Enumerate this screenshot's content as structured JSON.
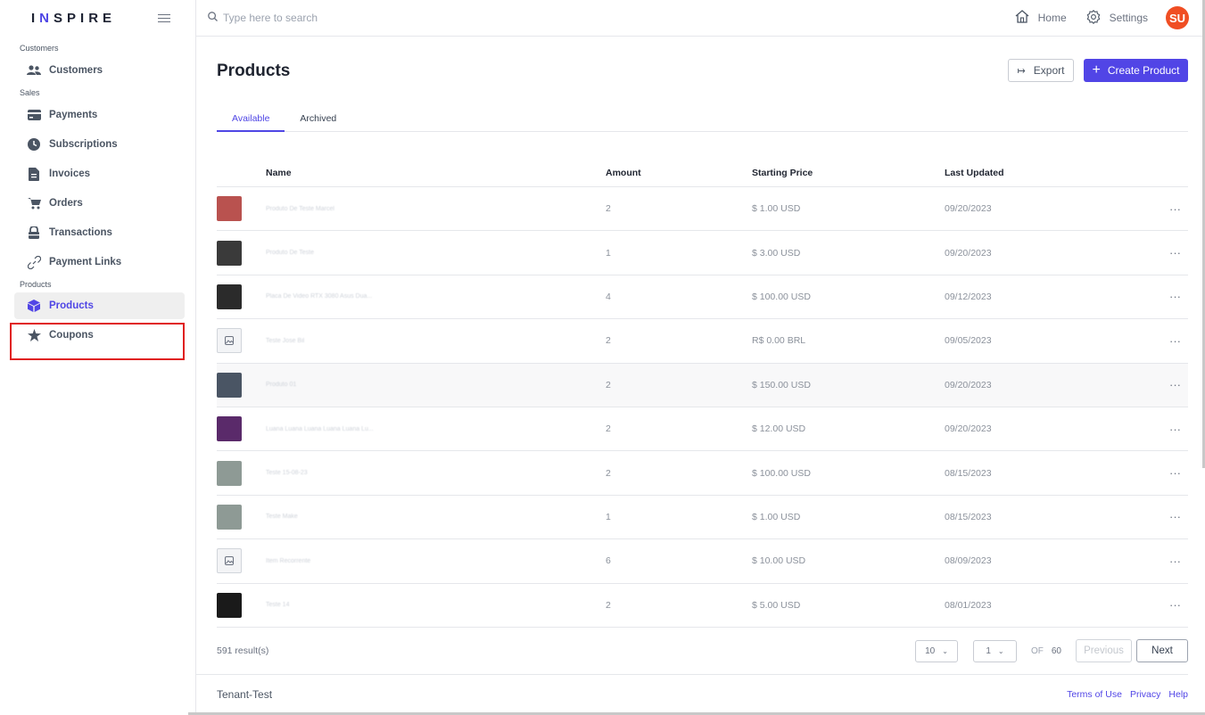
{
  "brand": {
    "logo_a": "I",
    "logo_n": "N",
    "logo_b": "SPIRE"
  },
  "search": {
    "placeholder": "Type here to search"
  },
  "topbar": {
    "home": "Home",
    "settings": "Settings",
    "avatar": "SU"
  },
  "sidebar": {
    "sections": [
      {
        "label": "Customers",
        "items": [
          {
            "label": "Customers",
            "icon": "users-icon"
          }
        ]
      },
      {
        "label": "Sales",
        "items": [
          {
            "label": "Payments",
            "icon": "card-icon"
          },
          {
            "label": "Subscriptions",
            "icon": "clock-icon"
          },
          {
            "label": "Invoices",
            "icon": "document-icon"
          },
          {
            "label": "Orders",
            "icon": "cart-icon"
          },
          {
            "label": "Transactions",
            "icon": "lock-icon"
          },
          {
            "label": "Payment Links",
            "icon": "link-icon"
          }
        ]
      },
      {
        "label": "Products",
        "items": [
          {
            "label": "Products",
            "icon": "box-icon"
          },
          {
            "label": "Coupons",
            "icon": "star-icon"
          }
        ]
      }
    ]
  },
  "page": {
    "title": "Products",
    "export_label": "Export",
    "create_label": "Create Product"
  },
  "tabs": [
    "Available",
    "Archived"
  ],
  "table": {
    "headers": [
      "Name",
      "Amount",
      "Starting Price",
      "Last Updated"
    ],
    "rows": [
      {
        "name": "Produto De Teste Marcel",
        "amount": "2",
        "price": "$ 1.00 USD",
        "updated": "09/20/2023",
        "thumb": "#b9524f"
      },
      {
        "name": "Produto De Teste",
        "amount": "1",
        "price": "$ 3.00 USD",
        "updated": "09/20/2023",
        "thumb": "#3a3a3a"
      },
      {
        "name": "Placa De Video RTX 3080 Asus Dua...",
        "amount": "4",
        "price": "$ 100.00 USD",
        "updated": "09/12/2023",
        "thumb": "#2b2b2b"
      },
      {
        "name": "Teste Jose Bil",
        "amount": "2",
        "price": "R$ 0.00 BRL",
        "updated": "09/05/2023",
        "thumb": ""
      },
      {
        "name": "Produto 01",
        "amount": "2",
        "price": "$ 150.00 USD",
        "updated": "09/20/2023",
        "thumb": "#4a5564"
      },
      {
        "name": "Luana Luana Luana Luana Luana Lu...",
        "amount": "2",
        "price": "$ 12.00 USD",
        "updated": "09/20/2023",
        "thumb": "#5a2a6a"
      },
      {
        "name": "Teste 15-08-23",
        "amount": "2",
        "price": "$ 100.00 USD",
        "updated": "08/15/2023",
        "thumb": "#8e9a95"
      },
      {
        "name": "Teste Make",
        "amount": "1",
        "price": "$ 1.00 USD",
        "updated": "08/15/2023",
        "thumb": "#8e9a95"
      },
      {
        "name": "Item Recorrente",
        "amount": "6",
        "price": "$ 10.00 USD",
        "updated": "08/09/2023",
        "thumb": ""
      },
      {
        "name": "Teste 14",
        "amount": "2",
        "price": "$ 5.00 USD",
        "updated": "08/01/2023",
        "thumb": "#1a1a1a"
      }
    ]
  },
  "pagination": {
    "results": "591 result(s)",
    "per_page": "10",
    "page": "1",
    "of": "OF",
    "total_pages": "60",
    "prev": "Previous",
    "next": "Next"
  },
  "footer": {
    "tenant": "Tenant-Test",
    "terms": "Terms of Use",
    "privacy": "Privacy",
    "help": "Help"
  },
  "colors": {
    "accent": "#5145e6",
    "avatar": "#f04e23",
    "highlight": "#e01e1e"
  }
}
